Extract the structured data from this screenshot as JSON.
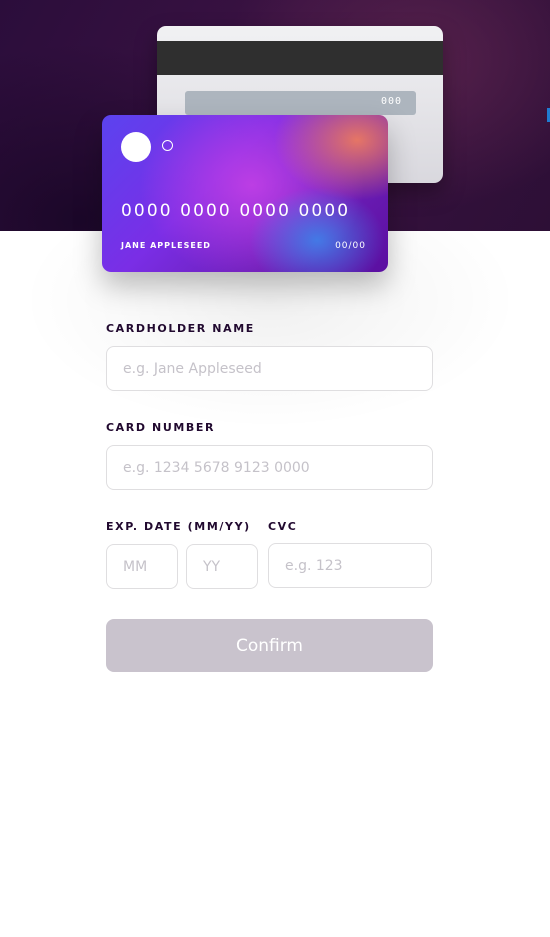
{
  "card_back": {
    "cvc": "000"
  },
  "card_front": {
    "number": "0000 0000 0000 0000",
    "name": "JANE APPLESEED",
    "expiry": "00/00"
  },
  "form": {
    "name_label": "CARDHOLDER NAME",
    "name_placeholder": "e.g. Jane Appleseed",
    "number_label": "CARD NUMBER",
    "number_placeholder": "e.g. 1234 5678 9123 0000",
    "exp_label": "EXP. DATE (MM/YY)",
    "month_placeholder": "MM",
    "year_placeholder": "YY",
    "cvc_label": "CVC",
    "cvc_placeholder": "e.g. 123",
    "confirm_label": "Confirm"
  },
  "colors": {
    "hero_dark": "#2b0d3b",
    "label_text": "#21092f",
    "input_border": "#dfdee0",
    "placeholder": "#c5c2c9",
    "confirm_bg": "#c9c3cd"
  }
}
